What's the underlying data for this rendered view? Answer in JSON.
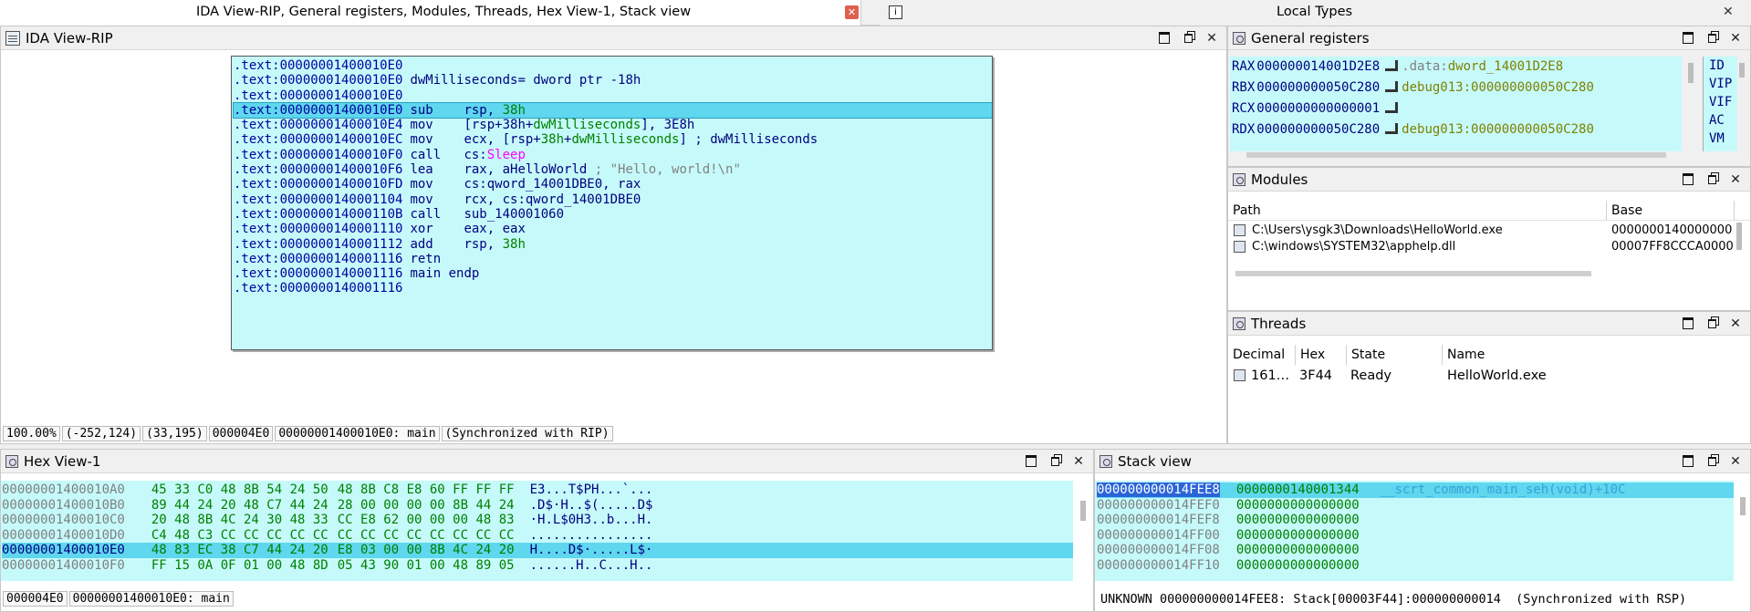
{
  "top_tabs": {
    "left_title": "IDA View-RIP, General registers, Modules, Threads, Hex View-1, Stack view",
    "right_title": "Local Types"
  },
  "ida_view": {
    "title": "IDA View-RIP",
    "lines": [
      {
        "addr": ".text:00000001400010E0",
        "mnem": "",
        "ops": [],
        "comment": ""
      },
      {
        "addr": ".text:00000001400010E0",
        "mnem": "dwMilliseconds= dword ptr -18h",
        "ops": [],
        "comment": ""
      },
      {
        "addr": ".text:00000001400010E0",
        "mnem": "",
        "ops": [],
        "comment": ""
      },
      {
        "addr": ".text:00000001400010E0",
        "mnem": "sub",
        "ops": [
          {
            "t": "rsp, ",
            "c": "op"
          },
          {
            "t": "38h",
            "c": "num"
          }
        ],
        "comment": "",
        "highlight": true
      },
      {
        "addr": ".text:00000001400010E4",
        "mnem": "mov",
        "ops": [
          {
            "t": "[rsp+38h+",
            "c": "op"
          },
          {
            "t": "dwMilliseconds",
            "c": "var"
          },
          {
            "t": "], 3E8h",
            "c": "op"
          }
        ],
        "comment": ""
      },
      {
        "addr": ".text:00000001400010EC",
        "mnem": "mov",
        "ops": [
          {
            "t": "ecx, [rsp+",
            "c": "op"
          },
          {
            "t": "38h",
            "c": "num"
          },
          {
            "t": "+",
            "c": "op"
          },
          {
            "t": "dwMilliseconds",
            "c": "var"
          },
          {
            "t": "] ; dwMilliseconds",
            "c": "op"
          }
        ],
        "comment": ""
      },
      {
        "addr": ".text:00000001400010F0",
        "mnem": "call",
        "ops": [
          {
            "t": "cs:",
            "c": "op"
          },
          {
            "t": "Sleep",
            "c": "imp"
          }
        ],
        "comment": ""
      },
      {
        "addr": ".text:00000001400010F6",
        "mnem": "lea",
        "ops": [
          {
            "t": "rax, aHelloWorld",
            "c": "op"
          }
        ],
        "comment": " ; \"Hello, world!\\n\""
      },
      {
        "addr": ".text:00000001400010FD",
        "mnem": "mov",
        "ops": [
          {
            "t": "cs:qword_14001DBE0, rax",
            "c": "op"
          }
        ],
        "comment": ""
      },
      {
        "addr": ".text:0000000140001104",
        "mnem": "mov",
        "ops": [
          {
            "t": "rcx, cs:qword_14001DBE0",
            "c": "op"
          }
        ],
        "comment": ""
      },
      {
        "addr": ".text:000000014000110B",
        "mnem": "call",
        "ops": [
          {
            "t": "sub_140001060",
            "c": "op"
          }
        ],
        "comment": ""
      },
      {
        "addr": ".text:0000000140001110",
        "mnem": "xor",
        "ops": [
          {
            "t": "eax, eax",
            "c": "op"
          }
        ],
        "comment": ""
      },
      {
        "addr": ".text:0000000140001112",
        "mnem": "add",
        "ops": [
          {
            "t": "rsp, ",
            "c": "op"
          },
          {
            "t": "38h",
            "c": "num"
          }
        ],
        "comment": ""
      },
      {
        "addr": ".text:0000000140001116",
        "mnem": "retn",
        "ops": [],
        "comment": ""
      },
      {
        "addr": ".text:0000000140001116",
        "mnem": "main endp",
        "ops": [],
        "comment": ""
      },
      {
        "addr": ".text:0000000140001116",
        "mnem": "",
        "ops": [],
        "comment": ""
      }
    ],
    "status": [
      "100.00%",
      "(-252,124)",
      "(33,195)",
      "000004E0",
      "00000001400010E0: main",
      "(Synchronized with RIP)"
    ]
  },
  "registers": {
    "title": "General registers",
    "rows": [
      {
        "name": "RAX",
        "value": "000000014001D2E8",
        "seg": ".data:",
        "target": "dword_14001D2E8"
      },
      {
        "name": "RBX",
        "value": "000000000050C280",
        "seg": "",
        "target": "debug013:000000000050C280"
      },
      {
        "name": "RCX",
        "value": "0000000000000001",
        "seg": "",
        "target": ""
      },
      {
        "name": "RDX",
        "value": "000000000050C280",
        "seg": "",
        "target": "debug013:000000000050C280"
      }
    ],
    "flags": [
      "ID",
      "VIP",
      "VIF",
      "AC",
      "VM"
    ]
  },
  "modules": {
    "title": "Modules",
    "columns": [
      "Path",
      "Base"
    ],
    "rows": [
      {
        "path": "C:\\Users\\ysgk3\\Downloads\\HelloWorld.exe",
        "base": "0000000140000000"
      },
      {
        "path": "C:\\windows\\SYSTEM32\\apphelp.dll",
        "base": "00007FF8CCCA0000"
      }
    ]
  },
  "threads": {
    "title": "Threads",
    "columns": [
      "Decimal",
      "Hex",
      "State",
      "Name"
    ],
    "rows": [
      {
        "decimal": "161…",
        "hex": "3F44",
        "state": "Ready",
        "name": "HelloWorld.exe"
      }
    ]
  },
  "hex_view": {
    "title": "Hex View-1",
    "rows": [
      {
        "addr": "00000001400010A0",
        "g1": "45 33 C0 48 8B 54 24 50",
        "g2": "48 8B C8 E8 60 FF FF FF",
        "ascii": "E3...T$PH...`..."
      },
      {
        "addr": "00000001400010B0",
        "g1": "89 44 24 20 48 C7 44 24",
        "g2": "28 00 00 00 00 8B 44 24",
        "ascii": ".D$·H..$(.....D$"
      },
      {
        "addr": "00000001400010C0",
        "g1": "20 48 8B 4C 24 30 48 33",
        "g2": "CC E8 62 00 00 00 48 83",
        "ascii": "·H.L$0H3..b...H."
      },
      {
        "addr": "00000001400010D0",
        "g1": "C4 48 C3 CC CC CC CC CC",
        "g2": "CC CC CC CC CC CC CC CC",
        "ascii": "................"
      },
      {
        "addr": "00000001400010E0",
        "g1": "48 83 EC 38 C7 44 24 20",
        "g2": "E8 03 00 00 8B 4C 24 20",
        "ascii": "H....D$·.....L$·",
        "highlight": true
      },
      {
        "addr": "00000001400010F0",
        "g1": "FF 15 0A 0F 01 00 48 8D",
        "g2": "05 43 90 01 00 48 89 05",
        "ascii": "......H..C...H.."
      }
    ],
    "status": [
      "000004E0",
      "00000001400010E0: main"
    ]
  },
  "stack_view": {
    "title": "Stack view",
    "rows": [
      {
        "addr": "000000000014FEE8",
        "value": "0000000140001344",
        "comment": "__scrt_common_main_seh(void)+10C",
        "highlight": true
      },
      {
        "addr": "000000000014FEF0",
        "value": "0000000000000000",
        "comment": ""
      },
      {
        "addr": "000000000014FEF8",
        "value": "0000000000000000",
        "comment": ""
      },
      {
        "addr": "000000000014FF00",
        "value": "0000000000000000",
        "comment": ""
      },
      {
        "addr": "000000000014FF08",
        "value": "0000000000000000",
        "comment": ""
      },
      {
        "addr": "000000000014FF10",
        "value": "0000000000000000",
        "comment": ""
      }
    ],
    "status": "UNKNOWN 000000000014FEE8: Stack[00003F44]:000000000014  (Synchronized with RSP)"
  }
}
